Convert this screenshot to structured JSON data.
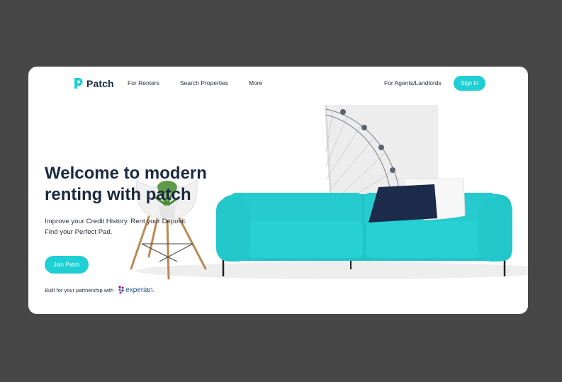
{
  "nav": {
    "logo_text": "Patch",
    "links": [
      "For Renters",
      "Search Properties",
      "More"
    ],
    "agents_link": "For Agents/Landlords",
    "signin_label": "Sign In"
  },
  "hero": {
    "title": "Welcome to modern renting with patch",
    "subtitle_line1": "Improve your Credit History. Rent your Deposit.",
    "subtitle_line2": "Find your Perfect Pad.",
    "join_label": "Join Patch"
  },
  "partner": {
    "text": "Built for your partnership with",
    "brand": "experian."
  },
  "colors": {
    "accent": "#1fcfd4",
    "sofa": "#22c9cc",
    "navy": "#1b2a3f",
    "backdrop": "#474747"
  }
}
